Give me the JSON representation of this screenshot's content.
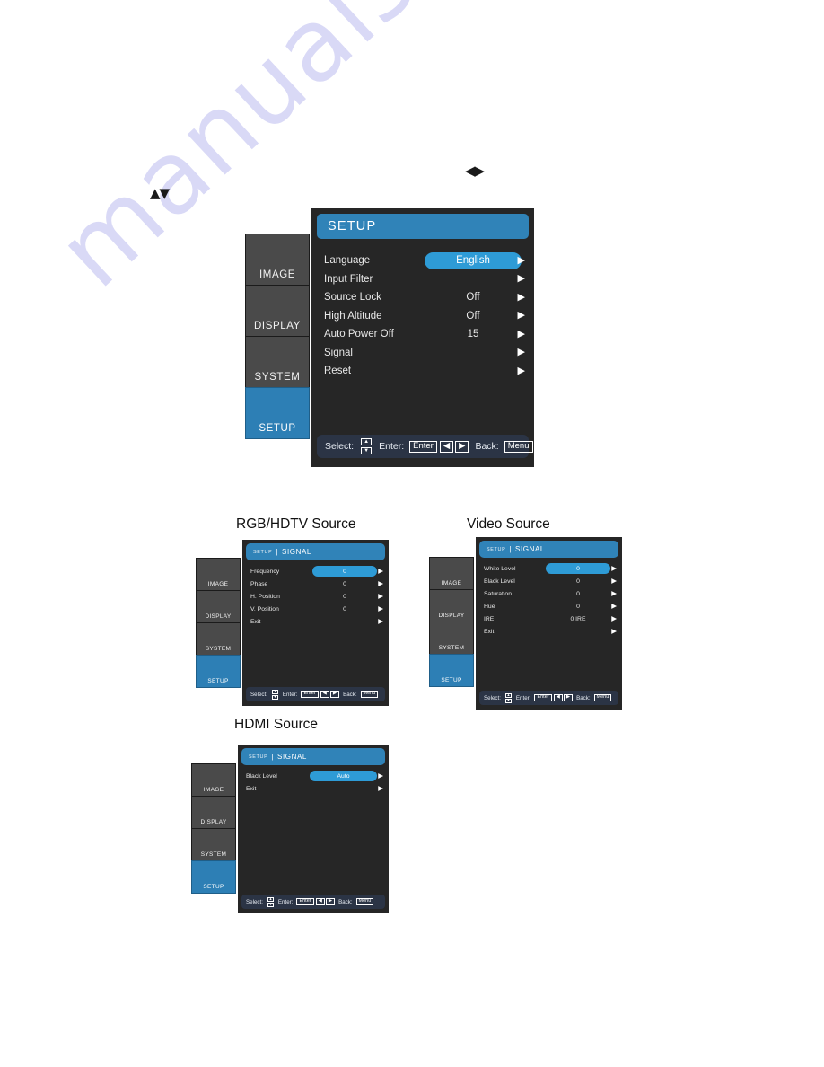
{
  "page": {
    "watermark_text": "manualshive.com",
    "watermark_color": "#d9d9f6",
    "background": "#ffffff",
    "accent_blue": "#3083b8",
    "highlight_blue": "#2e9bd6",
    "panel_dark": "#262626",
    "tab_gray": "#4a4a4a",
    "footer_navy": "#2b3445"
  },
  "marks": {
    "updown": "▲▼",
    "leftright": "◀▶"
  },
  "captions": {
    "rgb": "RGB/HDTV Source",
    "video": "Video Source",
    "hdmi": "HDMI Source"
  },
  "sidebar": {
    "items": [
      {
        "label": "IMAGE",
        "active": false
      },
      {
        "label": "DISPLAY",
        "active": false
      },
      {
        "label": "SYSTEM",
        "active": false
      },
      {
        "label": "SETUP",
        "active": true
      }
    ]
  },
  "footer": {
    "select_label": "Select:",
    "enter_label": "Enter:",
    "back_label": "Back:",
    "enter_key": "Enter",
    "menu_key": "Menu",
    "up_arrow": "▲",
    "down_arrow": "▼",
    "left_arrow": "◀",
    "right_arrow": "▶"
  },
  "setup_menu": {
    "title": "SETUP",
    "arrow_glyph": "▶",
    "rows": [
      {
        "label": "Language",
        "value": "English",
        "highlight": true
      },
      {
        "label": "Input Filter",
        "value": "",
        "highlight": false
      },
      {
        "label": "Source Lock",
        "value": "Off",
        "highlight": false
      },
      {
        "label": "High Altitude",
        "value": "Off",
        "highlight": false
      },
      {
        "label": "Auto Power Off",
        "value": "15",
        "highlight": false
      },
      {
        "label": "Signal",
        "value": "",
        "highlight": false
      },
      {
        "label": "Reset",
        "value": "",
        "highlight": false
      }
    ]
  },
  "rgb_menu": {
    "title_sup": "SETUP",
    "title_divider": "|",
    "title": "SIGNAL",
    "rows": [
      {
        "label": "Frequency",
        "value": "0",
        "highlight": true
      },
      {
        "label": "Phase",
        "value": "0",
        "highlight": false
      },
      {
        "label": "H. Position",
        "value": "0",
        "highlight": false
      },
      {
        "label": "V. Position",
        "value": "0",
        "highlight": false
      },
      {
        "label": "Exit",
        "value": "",
        "highlight": false
      }
    ]
  },
  "video_menu": {
    "title_sup": "SETUP",
    "title_divider": "|",
    "title": "SIGNAL",
    "rows": [
      {
        "label": "White Level",
        "value": "0",
        "highlight": true
      },
      {
        "label": "Black Level",
        "value": "0",
        "highlight": false
      },
      {
        "label": "Saturation",
        "value": "0",
        "highlight": false
      },
      {
        "label": "Hue",
        "value": "0",
        "highlight": false
      },
      {
        "label": "IRE",
        "value": "0 IRE",
        "highlight": false
      },
      {
        "label": "Exit",
        "value": "",
        "highlight": false
      }
    ]
  },
  "hdmi_menu": {
    "title_sup": "SETUP",
    "title_divider": "|",
    "title": "SIGNAL",
    "rows": [
      {
        "label": "Black Level",
        "value": "Auto",
        "highlight": true
      },
      {
        "label": "Exit",
        "value": "",
        "highlight": false
      }
    ]
  }
}
